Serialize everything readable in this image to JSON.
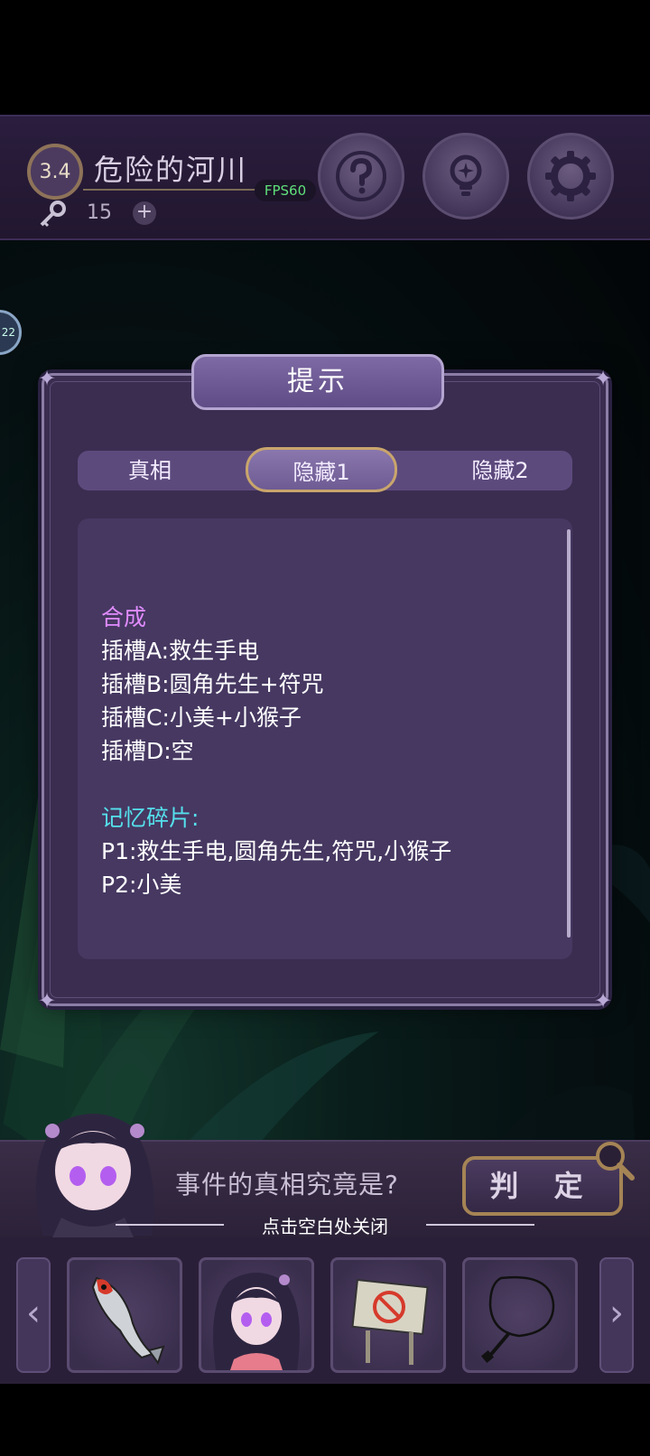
{
  "header": {
    "level": "3.4",
    "title": "危险的河川",
    "fps": "FPS60",
    "keys": "15",
    "plus": "+",
    "buttons": {
      "help_icon": "help-icon",
      "hint_icon": "lightbulb-icon",
      "settings_icon": "gear-icon"
    }
  },
  "side_tab": "22",
  "dialog": {
    "title": "提示",
    "tabs": [
      "真相",
      "隐藏1",
      "隐藏2"
    ],
    "active_tab": "隐藏1",
    "section1_title": "合成",
    "section1_lines": [
      "插槽A:救生手电",
      "插槽B:圆角先生+符咒",
      "插槽C:小美+小猴子",
      "插槽D:空"
    ],
    "section2_title": "记忆碎片:",
    "section2_lines": [
      "P1:救生手电,圆角先生,符咒,小猴子",
      "P2:小美"
    ]
  },
  "bottom": {
    "question": "事件的真相究竟是?",
    "judge": "判 定",
    "close_hint": "点击空白处关闭"
  },
  "inventory": {
    "left_arrow": "‹",
    "right_arrow": "›",
    "items": [
      "fish",
      "girl",
      "no-entry-sign",
      "net"
    ]
  },
  "colors": {
    "accent_pink": "#e08bff",
    "accent_cyan": "#55e0ec",
    "fps_green": "#5fe07a"
  }
}
